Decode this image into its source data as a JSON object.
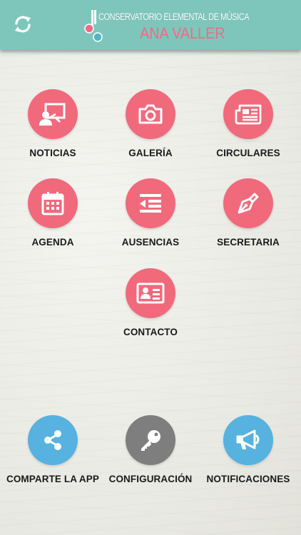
{
  "header": {
    "logo_line1": "CONSERVATORIO ELEMENTAL DE MÚSICA",
    "logo_line2": "ANA VALLER",
    "refresh_icon": "refresh-icon"
  },
  "colors": {
    "header_bg": "#7ec6bb",
    "pink": "#f06a7c",
    "blue": "#57b2df",
    "gray": "#7e7e7e",
    "logo_pink": "#f06a86"
  },
  "menu": [
    {
      "label": "NOTICIAS",
      "icon": "presentation-user-icon",
      "color": "pink"
    },
    {
      "label": "GALERÍA",
      "icon": "camera-icon",
      "color": "pink"
    },
    {
      "label": "CIRCULARES",
      "icon": "newspaper-icon",
      "color": "pink"
    },
    {
      "label": "AGENDA",
      "icon": "calendar-icon",
      "color": "pink"
    },
    {
      "label": "AUSENCIAS",
      "icon": "indent-list-icon",
      "color": "pink"
    },
    {
      "label": "SECRETARIA",
      "icon": "pen-nib-icon",
      "color": "pink"
    },
    {
      "label": "CONTACTO",
      "icon": "contact-card-icon",
      "color": "pink"
    }
  ],
  "bottom": [
    {
      "label": "COMPARTE LA APP",
      "icon": "share-icon",
      "color": "blue"
    },
    {
      "label": "CONFIGURACIÓN",
      "icon": "key-icon",
      "color": "gray"
    },
    {
      "label": "NOTIFICACIONES",
      "icon": "megaphone-icon",
      "color": "blue"
    }
  ]
}
